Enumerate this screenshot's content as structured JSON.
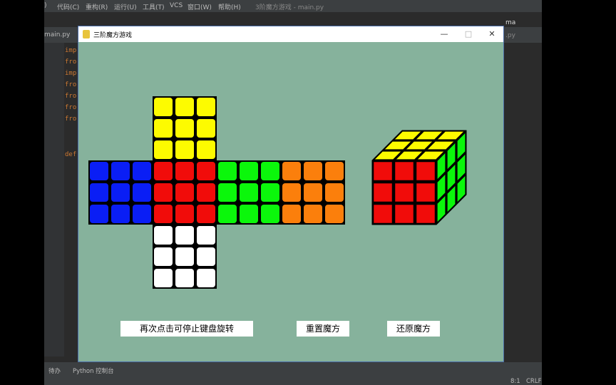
{
  "ide": {
    "menu": [
      ")",
      "代码(C)",
      "重构(R)",
      "运行(U)",
      "工具(T)",
      "VCS",
      "窗口(W)",
      "帮助(H)"
    ],
    "title": "3阶魔方游戏 - main.py",
    "tabs": {
      "left": "main.py",
      "right_active": "ma",
      "right_faded": ".py"
    },
    "code_lines": [
      "imp",
      "fro",
      "imp",
      "fro",
      "fro",
      "fro",
      "fro",
      "def"
    ],
    "status": {
      "todo": "待办",
      "console": "Python 控制台",
      "position": "8:1",
      "line_sep": "CRLF"
    }
  },
  "window": {
    "title": "三阶魔方游戏",
    "minimize_glyph": "—",
    "maximize_glyph": "□",
    "close_glyph": "✕"
  },
  "colors": {
    "yellow": "#fdfb00",
    "red": "#f10c0a",
    "green": "#0bf70b",
    "blue": "#0a1ef5",
    "orange": "#fb7f0c",
    "white": "#ffffff",
    "background": "#86b29c"
  },
  "cube_net": {
    "up": "yellow",
    "left": "blue",
    "front": "red",
    "right": "green",
    "back": "orange",
    "down": "white"
  },
  "cube_3d": {
    "top": "yellow",
    "front": "red",
    "side": "green"
  },
  "buttons": {
    "stop_rotation": "再次点击可停止键盘旋转",
    "reset": "重置魔方",
    "restore": "还原魔方"
  }
}
